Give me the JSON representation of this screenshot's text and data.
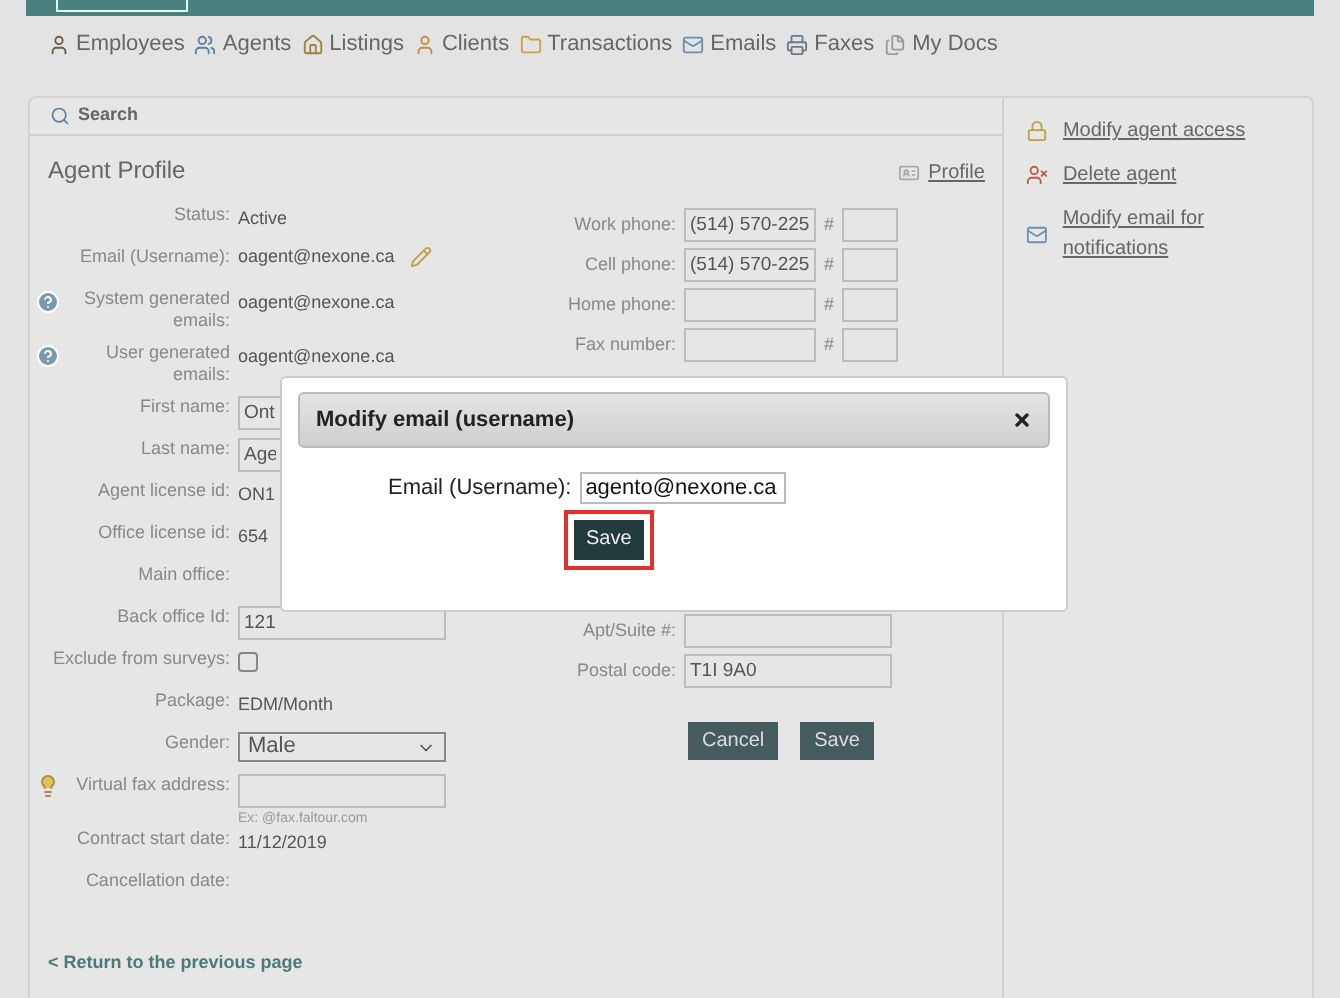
{
  "nav": [
    {
      "label": "Employees"
    },
    {
      "label": "Agents"
    },
    {
      "label": "Listings"
    },
    {
      "label": "Clients"
    },
    {
      "label": "Transactions"
    },
    {
      "label": "Emails"
    },
    {
      "label": "Faxes"
    },
    {
      "label": "My Docs"
    }
  ],
  "search": {
    "label": "Search"
  },
  "profile": {
    "title": "Agent Profile",
    "link": "Profile"
  },
  "left_fields": [
    {
      "kind": "text",
      "label": "Status:",
      "value": "Active"
    },
    {
      "kind": "editable",
      "label": "Email (Username):",
      "value": "oagent@nexone.ca"
    },
    {
      "kind": "help",
      "label": "System generated emails:",
      "value": "oagent@nexone.ca"
    },
    {
      "kind": "help",
      "label": "User generated emails:",
      "value": "oagent@nexone.ca"
    },
    {
      "kind": "input",
      "label": "First name:",
      "value": "Ont"
    },
    {
      "kind": "input",
      "label": "Last name:",
      "value": "Age"
    },
    {
      "kind": "text",
      "label": "Agent license id:",
      "value": "ON1"
    },
    {
      "kind": "text",
      "label": "Office license id:",
      "value": "654"
    },
    {
      "kind": "text",
      "label": "Main office:"
    },
    {
      "kind": "input",
      "label": "Back office Id:",
      "value": "121"
    },
    {
      "kind": "checkbox",
      "label": "Exclude from surveys:",
      "checked": false
    },
    {
      "kind": "text",
      "label": "Package:",
      "value": "EDM/Month"
    },
    {
      "kind": "select",
      "label": "Gender:",
      "value": "Male"
    },
    {
      "kind": "tip",
      "label": "Virtual fax address:",
      "hint": "Ex: @fax.faltour.com"
    },
    {
      "kind": "text",
      "label": "Contract start date:",
      "value": "11/12/2019"
    },
    {
      "kind": "text",
      "label": "Cancellation date:"
    }
  ],
  "phones": [
    {
      "label": "Work phone:",
      "value": "(514) 570-225",
      "ext_label": "#"
    },
    {
      "label": "Cell phone:",
      "value": "(514) 570-225",
      "ext_label": "#"
    },
    {
      "label": "Home phone:",
      "ext_label": "#"
    },
    {
      "label": "Fax number:",
      "ext_label": "#"
    }
  ],
  "address": [
    {
      "label": "Apt/Suite #:"
    },
    {
      "label": "Postal code:",
      "value": "T1I 9A0"
    }
  ],
  "form_buttons": [
    "Cancel",
    "Save"
  ],
  "sidebar": [
    {
      "label": "Modify agent access"
    },
    {
      "label": "Delete agent"
    },
    {
      "label": "Modify email for notifications"
    }
  ],
  "back_link": "< Return to the previous page",
  "modal": {
    "title": "Modify email (username)",
    "field_label": "Email (Username):",
    "value": "agento@nexone.ca",
    "button": "Save",
    "highlighted": true
  }
}
